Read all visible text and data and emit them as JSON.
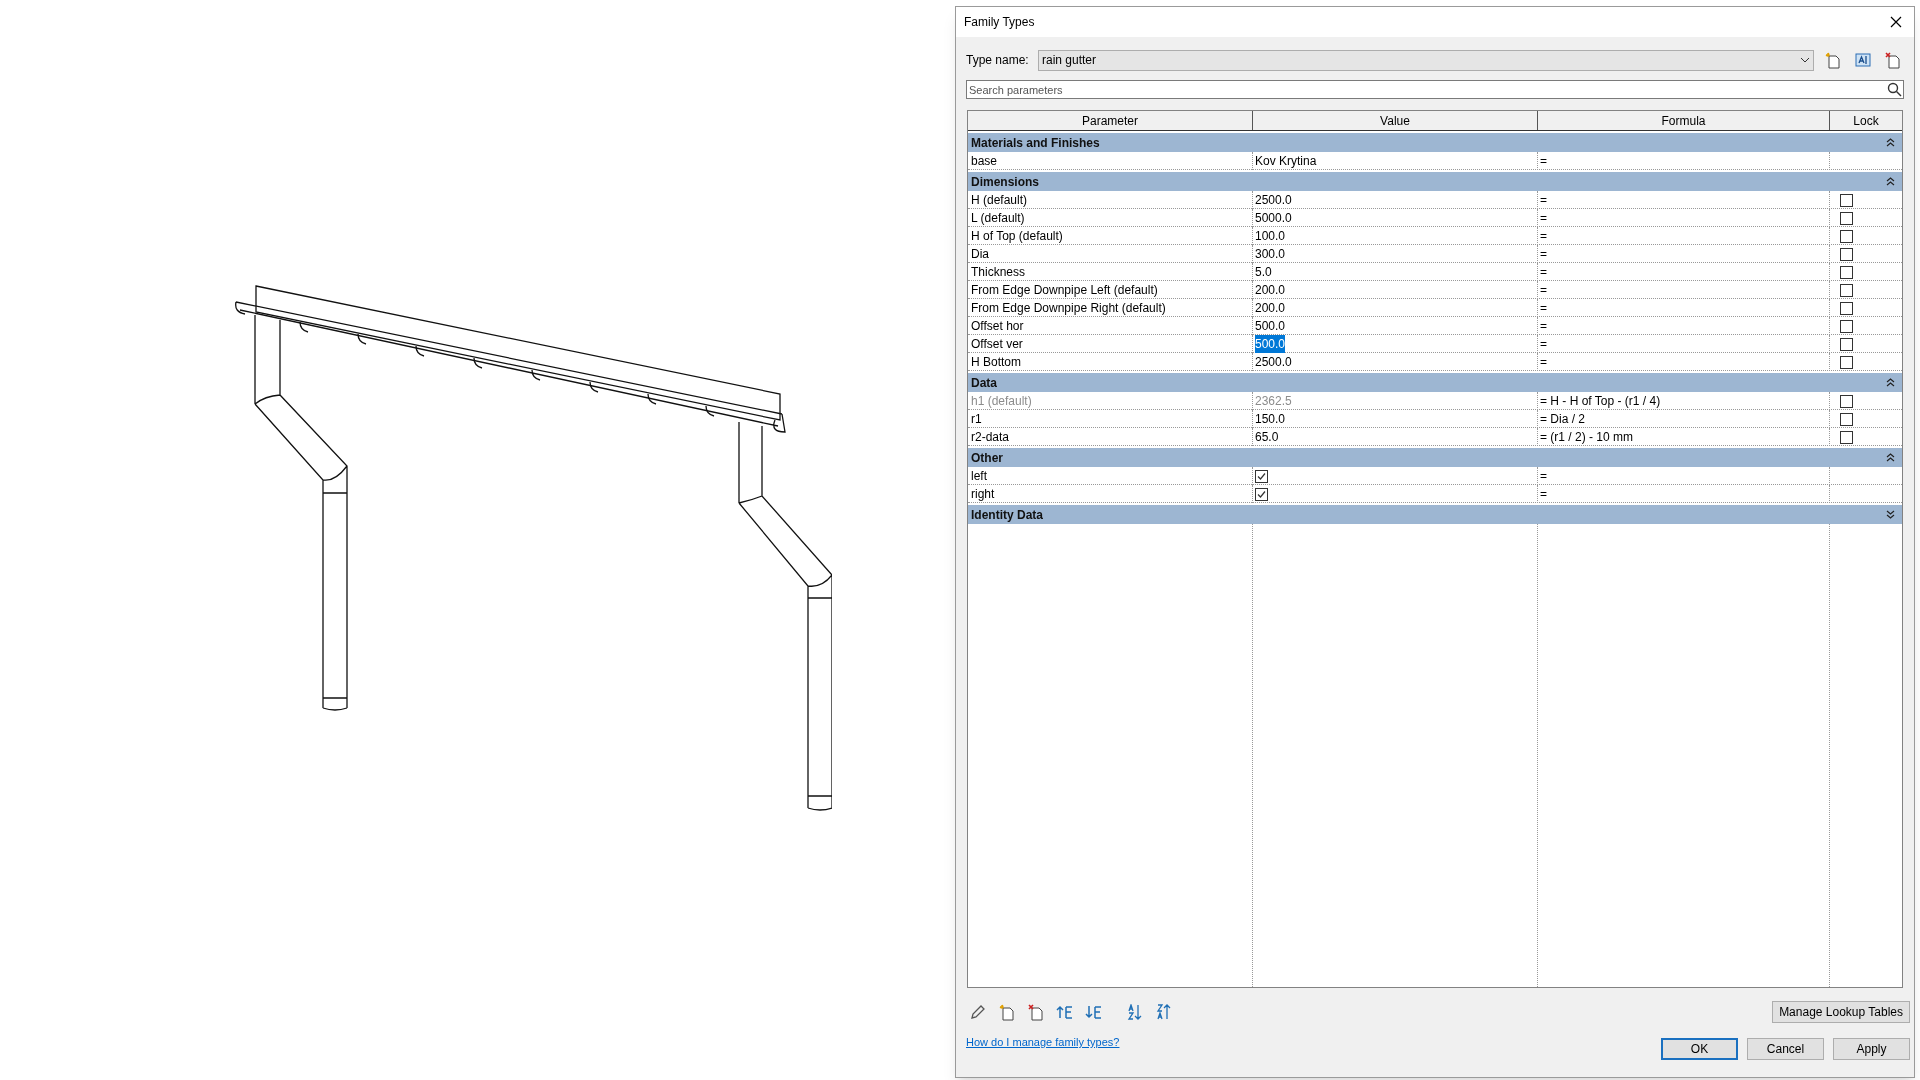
{
  "window": {
    "title": "Family Types"
  },
  "type_name": {
    "label": "Type name:",
    "value": "rain gutter"
  },
  "search": {
    "placeholder": "Search parameters"
  },
  "table": {
    "columns": [
      "Parameter",
      "Value",
      "Formula",
      "Lock"
    ],
    "sections": [
      {
        "title": "Materials and Finishes",
        "expanded": true,
        "rows": [
          {
            "kind": "text",
            "parameter": "base",
            "value": "Kov Krytina",
            "formula": "=",
            "disabled": false,
            "value_selected": false
          }
        ]
      },
      {
        "title": "Dimensions",
        "expanded": true,
        "rows": [
          {
            "kind": "text",
            "parameter": "H (default)",
            "value": "2500.0",
            "formula": "=",
            "locked": false,
            "disabled": false,
            "value_selected": false
          },
          {
            "kind": "text",
            "parameter": "L (default)",
            "value": "5000.0",
            "formula": "=",
            "locked": false,
            "disabled": false,
            "value_selected": false
          },
          {
            "kind": "text",
            "parameter": "H of Top (default)",
            "value": "100.0",
            "formula": "=",
            "locked": false,
            "disabled": false,
            "value_selected": false
          },
          {
            "kind": "text",
            "parameter": "Dia",
            "value": "300.0",
            "formula": "=",
            "locked": false,
            "disabled": false,
            "value_selected": false
          },
          {
            "kind": "text",
            "parameter": "Thickness",
            "value": "5.0",
            "formula": "=",
            "locked": false,
            "disabled": false,
            "value_selected": false
          },
          {
            "kind": "text",
            "parameter": "From Edge Downpipe Left (default)",
            "value": "200.0",
            "formula": "=",
            "locked": false,
            "disabled": false,
            "value_selected": false
          },
          {
            "kind": "text",
            "parameter": "From Edge Downpipe Right (default)",
            "value": "200.0",
            "formula": "=",
            "locked": false,
            "disabled": false,
            "value_selected": false
          },
          {
            "kind": "text",
            "parameter": "Offset hor",
            "value": "500.0",
            "formula": "=",
            "locked": false,
            "disabled": false,
            "value_selected": false
          },
          {
            "kind": "text",
            "parameter": "Offset ver",
            "value": "500.0",
            "formula": "=",
            "locked": false,
            "disabled": false,
            "value_selected": true
          },
          {
            "kind": "text",
            "parameter": "H Bottom",
            "value": "2500.0",
            "formula": "=",
            "locked": false,
            "disabled": false,
            "value_selected": false
          }
        ]
      },
      {
        "title": "Data",
        "expanded": true,
        "rows": [
          {
            "kind": "text",
            "parameter": "h1 (default)",
            "value": "2362.5",
            "formula": "= H - H of Top - (r1 / 4)",
            "locked": false,
            "disabled": true,
            "value_selected": false
          },
          {
            "kind": "text",
            "parameter": "r1",
            "value": "150.0",
            "formula": "= Dia / 2",
            "locked": false,
            "disabled": false,
            "value_selected": false
          },
          {
            "kind": "text",
            "parameter": "r2-data",
            "value": "65.0",
            "formula": "= (r1 / 2) - 10 mm",
            "locked": false,
            "disabled": false,
            "value_selected": false
          }
        ]
      },
      {
        "title": "Other",
        "expanded": true,
        "rows": [
          {
            "kind": "checkbox",
            "parameter": "left",
            "checked": true,
            "formula": "=",
            "disabled": false
          },
          {
            "kind": "checkbox",
            "parameter": "right",
            "checked": true,
            "formula": "=",
            "disabled": false
          }
        ]
      },
      {
        "title": "Identity Data",
        "expanded": false
      }
    ]
  },
  "buttons": {
    "manage": "Manage Lookup Tables",
    "ok": "OK",
    "cancel": "Cancel",
    "apply": "Apply"
  },
  "help_link": "How do I manage family types?"
}
